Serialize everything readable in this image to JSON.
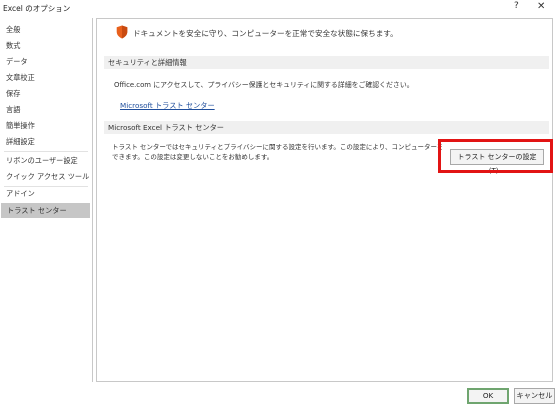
{
  "window": {
    "title": "Excel のオプション",
    "help_glyph": "?",
    "close_glyph": "✕"
  },
  "sidebar": {
    "items": [
      {
        "label": "全般"
      },
      {
        "label": "数式"
      },
      {
        "label": "データ"
      },
      {
        "label": "文章校正"
      },
      {
        "label": "保存"
      },
      {
        "label": "言語"
      },
      {
        "label": "簡単操作"
      },
      {
        "label": "詳細設定"
      },
      {
        "label": "リボンのユーザー設定"
      },
      {
        "label": "クイック アクセス ツール バー"
      },
      {
        "label": "アドイン"
      },
      {
        "label": "トラスト センター"
      }
    ],
    "selected": "トラスト センター"
  },
  "main": {
    "headline": "ドキュメントを安全に守り、コンピューターを正常で安全な状態に保ちます。",
    "headline_icon": "shield-icon",
    "privacy_section": {
      "header": "セキュリティと詳細情報",
      "text": "Office.com にアクセスして、プライバシー保護とセキュリティに関する詳細をご確認ください。",
      "link": "Microsoft トラスト センター"
    },
    "trust_section": {
      "header": "Microsoft Excel トラスト センター",
      "text_line1": "トラスト センターではセキュリティとプライバシーに関する設定を行います。この設定により、コンピューターを保護することが",
      "text_line2": "できます。この設定は変更しないことをお勧めします。",
      "button": "トラスト センターの設定(T)..."
    }
  },
  "footer": {
    "ok": "OK",
    "cancel": "キャンセル"
  },
  "colors": {
    "highlight": "#e21414",
    "link": "#1f4e9c",
    "selected_nav": "#c6c6c6",
    "shield": "#e8601c"
  }
}
